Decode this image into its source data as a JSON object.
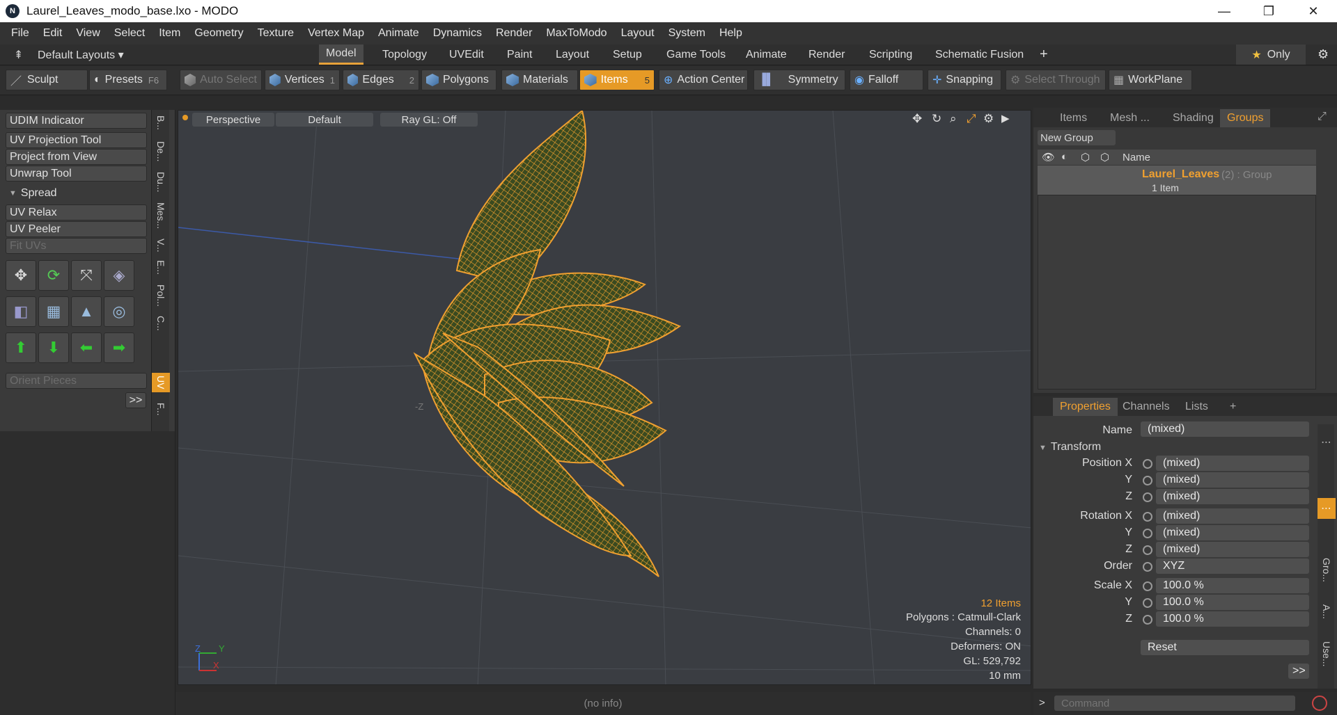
{
  "window": {
    "title": "Laurel_Leaves_modo_base.lxo - MODO",
    "logo": "N",
    "minimize": "—",
    "restore": "❐",
    "close": "✕"
  },
  "menu": [
    "File",
    "Edit",
    "View",
    "Select",
    "Item",
    "Geometry",
    "Texture",
    "Vertex Map",
    "Animate",
    "Dynamics",
    "Render",
    "MaxToModo",
    "Layout",
    "System",
    "Help"
  ],
  "layout": {
    "selector": "Default Layouts ▾",
    "tabs": [
      "Model",
      "Topology",
      "UVEdit",
      "Paint",
      "Layout",
      "Setup",
      "Game Tools",
      "Animate",
      "Render",
      "Scripting",
      "Schematic Fusion"
    ],
    "plus": "+",
    "only": "Only",
    "star": "★"
  },
  "toolbar": {
    "sculpt": "Sculpt",
    "presets": "Presets",
    "presets_key": "F6",
    "auto_select": "Auto Select",
    "vertices": "Vertices",
    "vertices_key": "1",
    "edges": "Edges",
    "edges_key": "2",
    "polygons": "Polygons",
    "materials": "Materials",
    "items": "Items",
    "items_key": "5",
    "action_center": "Action Center",
    "symmetry": "Symmetry",
    "falloff": "Falloff",
    "snapping": "Snapping",
    "select_through": "Select Through",
    "workplane": "WorkPlane"
  },
  "left": {
    "udim": "UDIM Indicator",
    "uv_projection": "UV Projection Tool",
    "project_view": "Project from View",
    "unwrap": "Unwrap Tool",
    "spread": "Spread",
    "uv_relax": "UV Relax",
    "uv_peeler": "UV Peeler",
    "fit_uvs": "Fit UVs",
    "orient": "Orient Pieces",
    "more": ">>",
    "vtabs": [
      "B...",
      "De...",
      "Du...",
      "Mes...",
      "V...",
      "E...",
      "Pol...",
      "C...",
      "UV",
      "F..."
    ]
  },
  "viewport": {
    "perspective": "Perspective",
    "default": "Default",
    "raygl": "Ray GL: Off",
    "axis_label": "-Z",
    "gizmo_z": "Z",
    "gizmo_y": "Y",
    "gizmo_x": "X",
    "info": {
      "items": "12 Items",
      "polygons": "Polygons : Catmull-Clark",
      "channels": "Channels: 0",
      "deformers": "Deformers: ON",
      "gl": "GL: 529,792",
      "size": "10 mm"
    }
  },
  "status": "(no info)",
  "groups": {
    "tabs": [
      "Items",
      "Mesh ...",
      "Shading",
      "Groups"
    ],
    "new_group": "New Group",
    "col_name": "Name",
    "item_name": "Laurel_Leaves",
    "item_suffix": "(2) : Group",
    "item_sub": "1 Item"
  },
  "properties": {
    "tabs": [
      "Properties",
      "Channels",
      "Lists"
    ],
    "plus": "+",
    "name_label": "Name",
    "name_value": "(mixed)",
    "section": "Transform",
    "rows": [
      {
        "label": "Position X",
        "value": "(mixed)"
      },
      {
        "label": "Y",
        "value": "(mixed)"
      },
      {
        "label": "Z",
        "value": "(mixed)"
      },
      {
        "label": "Rotation X",
        "value": "(mixed)"
      },
      {
        "label": "Y",
        "value": "(mixed)"
      },
      {
        "label": "Z",
        "value": "(mixed)"
      },
      {
        "label": "Order",
        "value": "XYZ"
      },
      {
        "label": "Scale X",
        "value": "100.0 %"
      },
      {
        "label": "Y",
        "value": "100.0 %"
      },
      {
        "label": "Z",
        "value": "100.0 %"
      }
    ],
    "reset": "Reset",
    "more": ">>",
    "side_tabs": [
      "Gro...",
      "A...",
      "Use..."
    ]
  },
  "command": {
    "prompt": ">",
    "placeholder": "Command"
  },
  "colors": {
    "accent": "#e69a26",
    "wire": "#f0a030",
    "leaf": "#3a4a20"
  }
}
